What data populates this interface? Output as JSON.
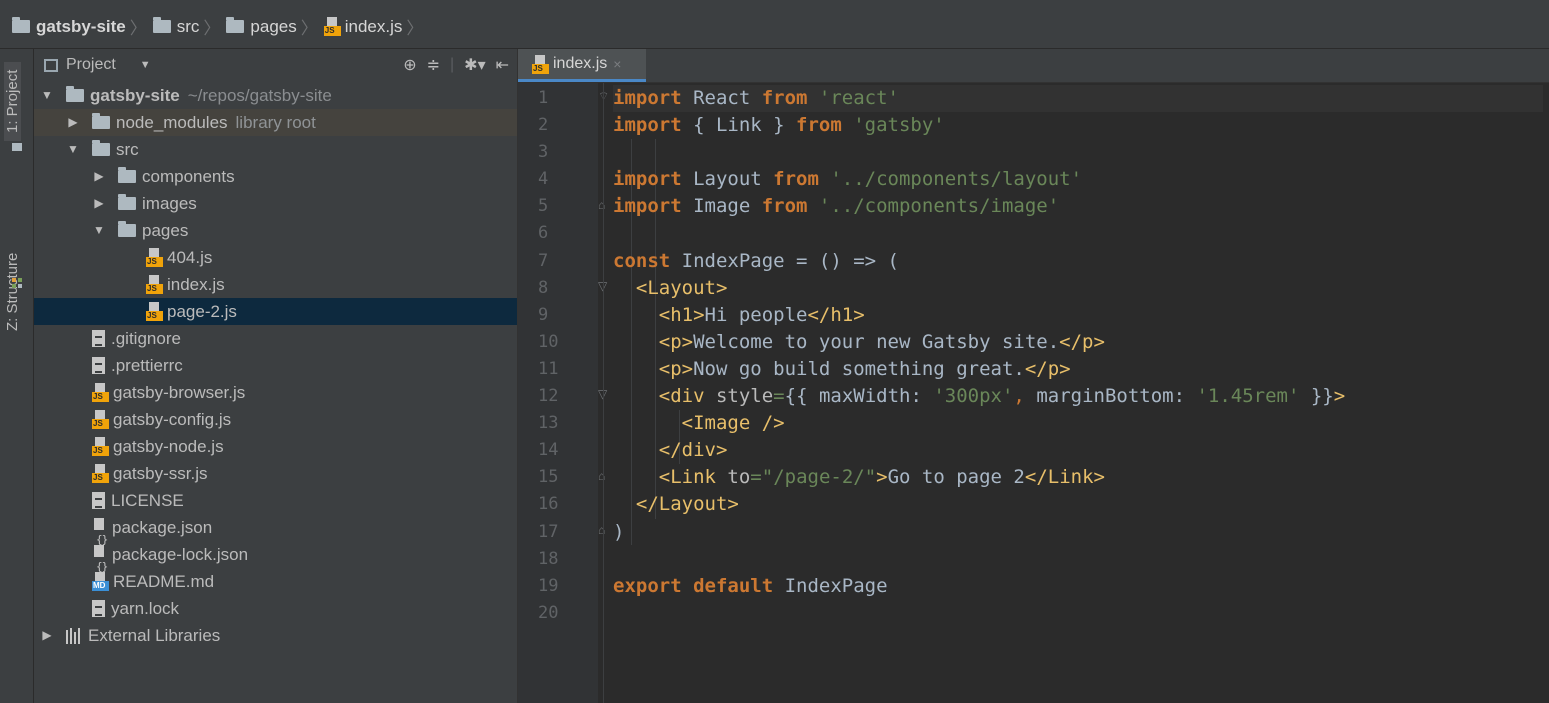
{
  "breadcrumb": [
    {
      "label": "gatsby-site",
      "icon": "folder-icon"
    },
    {
      "label": "src",
      "icon": "folder-icon"
    },
    {
      "label": "pages",
      "icon": "folder-icon"
    },
    {
      "label": "index.js",
      "icon": "js-file-icon"
    }
  ],
  "tool_stripe": {
    "project_tab": "1: Project",
    "structure_tab": "Z: Structure"
  },
  "project_panel": {
    "title": "Project",
    "root": {
      "label": "gatsby-site",
      "path": "~/repos/gatsby-site"
    },
    "items": [
      {
        "label": "node_modules",
        "hint": "library root",
        "type": "folder"
      },
      {
        "label": "src",
        "type": "folder"
      },
      {
        "label": "components",
        "type": "folder"
      },
      {
        "label": "images",
        "type": "folder"
      },
      {
        "label": "pages",
        "type": "folder"
      },
      {
        "label": "404.js",
        "type": "js"
      },
      {
        "label": "index.js",
        "type": "js"
      },
      {
        "label": "page-2.js",
        "type": "js"
      },
      {
        "label": ".gitignore",
        "type": "text"
      },
      {
        "label": ".prettierrc",
        "type": "text"
      },
      {
        "label": "gatsby-browser.js",
        "type": "js"
      },
      {
        "label": "gatsby-config.js",
        "type": "js"
      },
      {
        "label": "gatsby-node.js",
        "type": "js"
      },
      {
        "label": "gatsby-ssr.js",
        "type": "js"
      },
      {
        "label": "LICENSE",
        "type": "text"
      },
      {
        "label": "package.json",
        "type": "json"
      },
      {
        "label": "package-lock.json",
        "type": "json"
      },
      {
        "label": "README.md",
        "type": "md"
      },
      {
        "label": "yarn.lock",
        "type": "text"
      },
      {
        "label": "External Libraries",
        "type": "library"
      }
    ]
  },
  "editor": {
    "tab_label": "index.js",
    "line_numbers": [
      "1",
      "2",
      "3",
      "4",
      "5",
      "6",
      "7",
      "8",
      "9",
      "10",
      "11",
      "12",
      "13",
      "14",
      "15",
      "16",
      "17",
      "18",
      "19",
      "20"
    ],
    "code": {
      "l1_import": "import",
      "l1_name": " React ",
      "l1_from": "from",
      "l1_str": " 'react'",
      "l2_import": "import",
      "l2_name": " { Link } ",
      "l2_from": "from",
      "l2_str": " 'gatsby'",
      "l4_import": "import",
      "l4_name": " Layout ",
      "l4_from": "from",
      "l4_str": " '../components/layout'",
      "l5_import": "import",
      "l5_name": " Image ",
      "l5_from": "from",
      "l5_str": " '../components/image'",
      "l7_const": "const",
      "l7_rest": " IndexPage = () => (",
      "l8_tag": "<Layout>",
      "l9_open": "<h1>",
      "l9_text": "Hi people",
      "l9_close": "</h1>",
      "l10_open": "<p>",
      "l10_text": "Welcome to your new Gatsby site.",
      "l10_close": "</p>",
      "l11_open": "<p>",
      "l11_text": "Now go build something great.",
      "l11_close": "</p>",
      "l12_open": "<div ",
      "l12_attr": "style",
      "l12_eq": "=",
      "l12_a": "{{ maxWidth: ",
      "l12_s1": "'300px'",
      "l12_comma": ",",
      "l12_b": " marginBottom: ",
      "l12_s2": "'1.45rem'",
      "l12_c": " }}",
      "l12_gt": ">",
      "l13_tag": "<Image />",
      "l14_tag": "</div>",
      "l15_open": "<Link ",
      "l15_attr": "to",
      "l15_eq": "=",
      "l15_str": "\"/page-2/\"",
      "l15_gt": ">",
      "l15_text": "Go to page 2",
      "l15_close": "</Link>",
      "l16_tag": "</Layout>",
      "l17": ")",
      "l19_export": "export",
      "l19_default": " default",
      "l19_name": " IndexPage"
    }
  }
}
